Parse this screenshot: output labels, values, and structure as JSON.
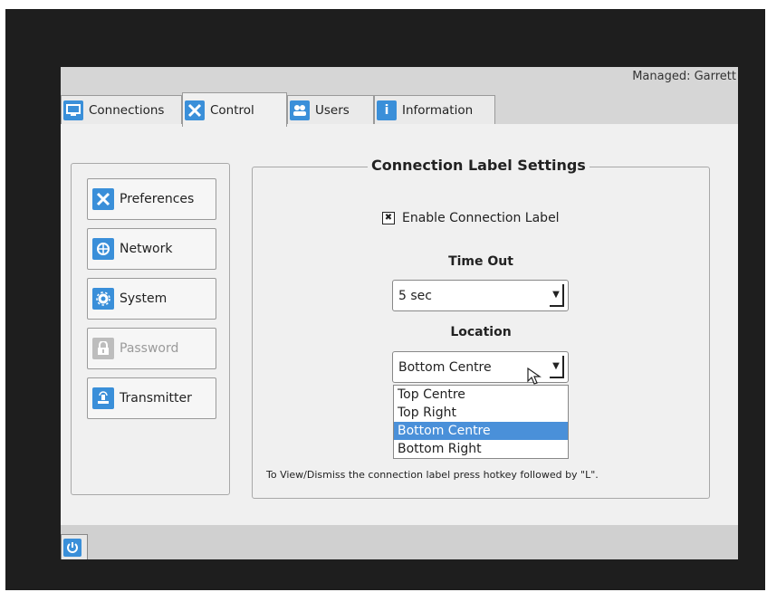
{
  "header": {
    "managed_text": "Managed: Garrett"
  },
  "tabs": [
    {
      "label": "Connections",
      "icon": "monitor-icon"
    },
    {
      "label": "Control",
      "icon": "tools-icon"
    },
    {
      "label": "Users",
      "icon": "users-icon"
    },
    {
      "label": "Information",
      "icon": "info-icon"
    }
  ],
  "active_tab": "Control",
  "sidebar": {
    "items": [
      {
        "label": "Preferences",
        "icon": "tools-icon"
      },
      {
        "label": "Network",
        "icon": "globe-icon"
      },
      {
        "label": "System",
        "icon": "gear-icon"
      },
      {
        "label": "Password",
        "icon": "lock-icon",
        "disabled": true
      },
      {
        "label": "Transmitter",
        "icon": "transmitter-icon"
      }
    ]
  },
  "settings": {
    "title": "Connection Label Settings",
    "enable_label": "Enable Connection Label",
    "enable_checked": true,
    "timeout_label": "Time Out",
    "timeout_value": "5 sec",
    "location_label": "Location",
    "location_value": "Bottom Centre",
    "location_options": [
      "Top Centre",
      "Top Right",
      "Bottom Centre",
      "Bottom Right"
    ],
    "location_selected_index": 2,
    "hint": "To View/Dismiss the connection label press hotkey followed by \"L\"."
  },
  "colors": {
    "accent": "#3a8fd9",
    "selection": "#4a90d9"
  }
}
